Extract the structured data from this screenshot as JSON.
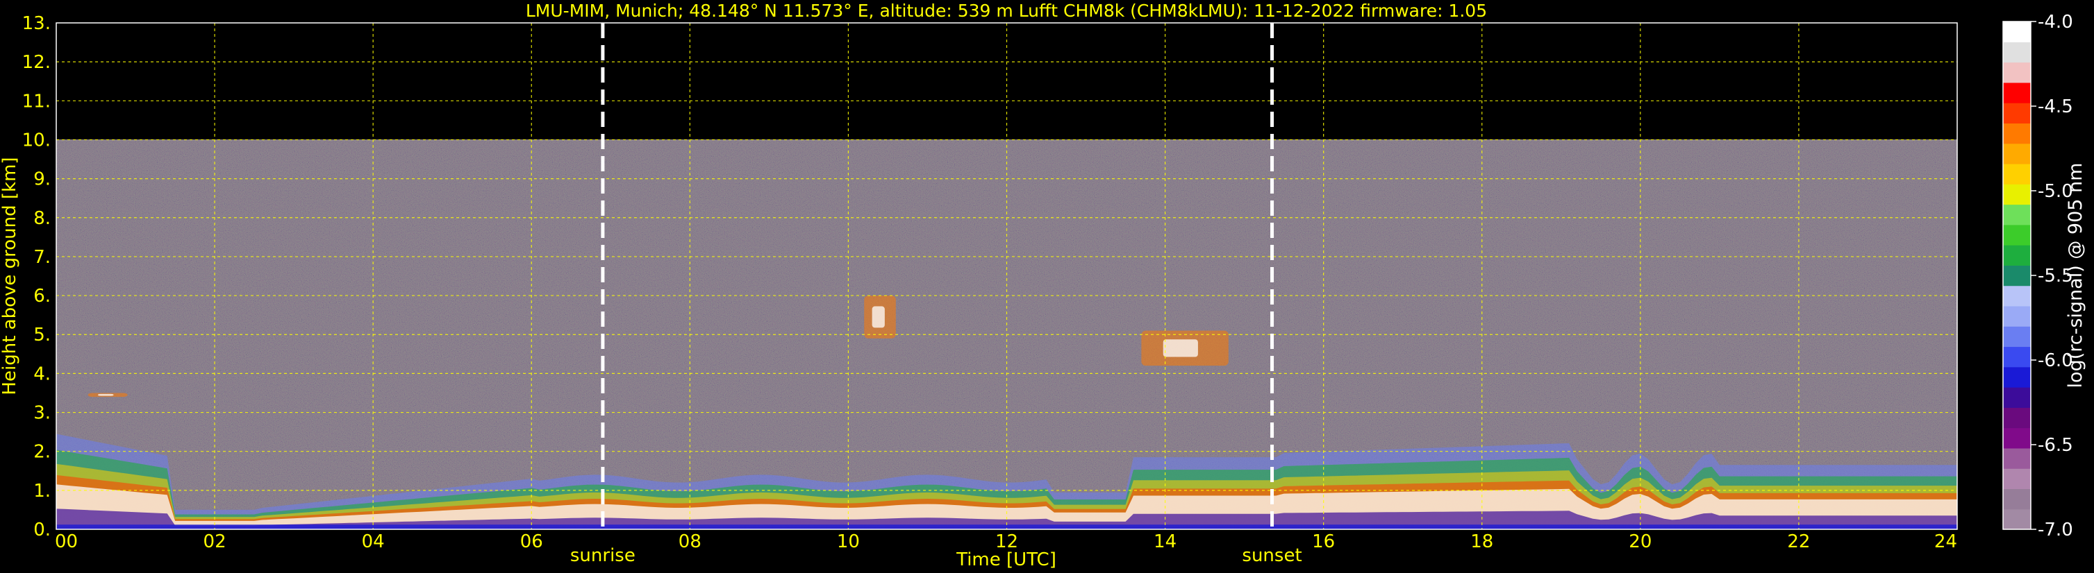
{
  "chart_data": {
    "type": "heatmap",
    "title": "LMU-MIM, Munich; 48.148° N 11.573° E, altitude: 539 m    Lufft CHM8k (CHM8kLMU): 11-12-2022    firmware: 1.05",
    "xlabel": "Time [UTC]",
    "ylabel": "Height above ground [km]",
    "xlim": [
      0,
      24
    ],
    "ylim": [
      0,
      13
    ],
    "x_ticks": [
      "00",
      "02",
      "04",
      "06",
      "08",
      "10",
      "12",
      "14",
      "16",
      "18",
      "20",
      "22",
      "24"
    ],
    "y_ticks": [
      "0.",
      "1.",
      "2.",
      "3.",
      "4.",
      "5.",
      "6.",
      "7.",
      "8.",
      "9.",
      "10.",
      "11.",
      "12.",
      "13."
    ],
    "grid": true,
    "signal_top_km": 10,
    "events": [
      {
        "label": "sunrise",
        "time": 6.9
      },
      {
        "label": "sunset",
        "time": 15.35
      }
    ],
    "colorbar": {
      "label": "log(rc-signal) @ 905 nm",
      "range": [
        -7.0,
        -4.0
      ],
      "ticks": [
        "-4.0",
        "-4.5",
        "-5.0",
        "-5.5",
        "-6.0",
        "-6.5",
        "-7.0"
      ],
      "colors": [
        "#a28aa4",
        "#967d99",
        "#b086ae",
        "#9a5a9c",
        "#800a8a",
        "#6a0a7e",
        "#3c0c9a",
        "#1a1ad6",
        "#3a4af0",
        "#6a7ef2",
        "#9aaaf6",
        "#b8c4f8",
        "#1a8a6a",
        "#1eae3e",
        "#3ccc2a",
        "#6ee05a",
        "#e8f000",
        "#ffd000",
        "#ffaa00",
        "#ff7a00",
        "#ff3a00",
        "#ff0000",
        "#f2c2c2",
        "#e0e0e0",
        "#ffffff"
      ]
    },
    "features": [
      {
        "name": "aerosol-boundary-layer",
        "height_km": [
          0,
          2
        ]
      },
      {
        "name": "clouds-10-11h",
        "time": [
          10.2,
          10.6
        ],
        "height_km": [
          4.9,
          6.0
        ]
      },
      {
        "name": "clouds-13-14h",
        "time": [
          13.7,
          14.8
        ],
        "height_km": [
          4.2,
          5.1
        ]
      },
      {
        "name": "layer-00-01h",
        "time": [
          0.4,
          0.9
        ],
        "height_km": [
          3.4,
          3.5
        ]
      }
    ]
  }
}
